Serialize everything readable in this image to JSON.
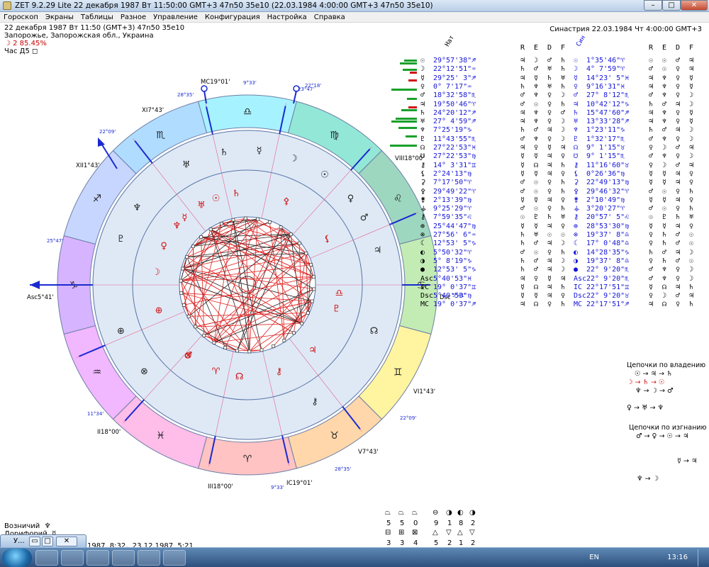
{
  "window": {
    "title": "ZET 9.2.29 Lite   22 декабря 1987  Вт  11:50:00 GMT+3 47n50  35e10   (22.03.1984   4:00:00 GMT+3 47n50 35e10)"
  },
  "menu": [
    "Гороскоп",
    "Экраны",
    "Таблицы",
    "Разное",
    "Управление",
    "Конфигурация",
    "Настройка",
    "Справка"
  ],
  "info": {
    "line1": "22 декабря 1987  Вт  11:50 (GMT+3)  47n50  35e10",
    "line2": "Запорожье, Запорожская обл., Украина",
    "line3": "☽   2  85.45%",
    "line4": "Час Д5  ◻",
    "right": "Синастрия 22.03.1984  Чт  4:00:00 GMT+3"
  },
  "wheel": {
    "mc": "MC19°01'",
    "asc": "Asc5°41'",
    "dsc": "Dsc",
    "ic": "IC19°01'",
    "vi": "VI1°43'",
    "v": "V7°43'",
    "xi": "XI7°43'",
    "xii": "XII1°43'",
    "ii": "II18°00'",
    "iii": "III18°00'",
    "viii": "VIII18°00'",
    "t1": "28°35'",
    "t2": "9°33'",
    "t3": "22°18'",
    "t4": "23°47'",
    "t5": "22°09'",
    "t6": "25°47'",
    "t7": "11°34'",
    "t8": "22°09'",
    "t9": "28°35'",
    "t10": "9°33'",
    "t11": "5°41'",
    "signs": [
      "♐",
      "♏",
      "♎",
      "♍",
      "♌",
      "♋",
      "♊",
      "♉",
      "♈",
      "♓",
      "♒",
      "♑"
    ]
  },
  "table": {
    "headers": [
      "Нат",
      "R",
      "E",
      "D",
      "F",
      "Син",
      "R",
      "E",
      "D",
      "F"
    ],
    "rows": [
      [
        "☉",
        "29°57'38\"♐",
        "♃",
        "☽",
        "♂",
        "♄",
        "☉",
        "1°35'46\"♈",
        "☉",
        "☉",
        "♂",
        "♃"
      ],
      [
        "☽",
        "22°12'51\"♒",
        "♄",
        "♂",
        "♅",
        "♄",
        "☽",
        "4° 7'59\"♈",
        "♂",
        "☉",
        "♀",
        "♃"
      ],
      [
        "☿",
        "29°25' 3\"♐",
        "♃",
        "☿",
        "♄",
        "♅",
        "☿",
        "14°23' 5\"♓",
        "♃",
        "♆",
        "♀",
        "☿"
      ],
      [
        "♀",
        "0° 7'17\"♒",
        "♄",
        "♆",
        "♅",
        "♄",
        "♀",
        "9°16'31\"♓",
        "♃",
        "♆",
        "♀",
        "☿"
      ],
      [
        "♂",
        "18°32'58\"♏",
        "♂",
        "♆",
        "♀",
        "☽",
        "♂",
        "27° 8'12\"♏",
        "♂",
        "♆",
        "♀",
        "☽"
      ],
      [
        "♃",
        "19°50'46\"♈",
        "♂",
        "☉",
        "♀",
        "♄",
        "♃",
        "10°42'12\"♑",
        "♄",
        "♂",
        "♃",
        "☽"
      ],
      [
        "♄",
        "24°20'12\"♐",
        "♃",
        "♆",
        "♀",
        "♂",
        "♄",
        "15°47'60\"♐",
        "♃",
        "♆",
        "♀",
        "☿"
      ],
      [
        "♅",
        "27° 4'59\"♐",
        "♃",
        "♆",
        "♀",
        "☽",
        "♅",
        "13°33'28\"♐",
        "♃",
        "♆",
        "♀",
        "☿"
      ],
      [
        "♆",
        "7°25'19\"♑",
        "♄",
        "♂",
        "♃",
        "☽",
        "♆",
        "1°23'11\"♑",
        "♄",
        "♂",
        "♃",
        "☽"
      ],
      [
        "♇",
        "11°43'55\"♏",
        "♂",
        "♆",
        "♀",
        "☽",
        "♇",
        "1°32'17\"♏",
        "♂",
        "♆",
        "♀",
        "☽"
      ],
      [
        "☊",
        "27°22'53\"♓",
        "♃",
        "♀",
        "☿",
        "♃",
        "☊",
        "9° 1'15\"♉",
        "♀",
        "☽",
        "♂",
        "♃"
      ],
      [
        "☋",
        "27°22'53\"♍",
        "☿",
        "☿",
        "♃",
        "♀",
        "☋",
        "9° 1'15\"♏",
        "♂",
        "♆",
        "♀",
        "☽"
      ],
      [
        "⚷",
        "14° 3'31\"♊",
        "☿",
        "☊",
        "♃",
        "♄",
        "⚷",
        "11°16'60\"♉",
        "♀",
        "☽",
        "♂",
        "♃"
      ],
      [
        "⚸",
        "2°24'13\"♍",
        "☿",
        "☿",
        "♃",
        "♀",
        "⚸",
        "0°26'36\"♍",
        "☿",
        "☿",
        "♃",
        "♀"
      ],
      [
        "⚳",
        "7°17'50\"♈",
        "♂",
        "☉",
        "♀",
        "♄",
        "⚳",
        "22°49'13\"♍",
        "☿",
        "☿",
        "♃",
        "♀"
      ],
      [
        "⚴",
        "29°49'22\"♈",
        "♂",
        "☉",
        "♀",
        "♄",
        "⚴",
        "29°46'32\"♈",
        "♂",
        "☉",
        "♀",
        "♄"
      ],
      [
        "⚵",
        "2°13'39\"♍",
        "☿",
        "☿",
        "♃",
        "♀",
        "⚵",
        "2°10'49\"♍",
        "☿",
        "☿",
        "♃",
        "♀"
      ],
      [
        "⚶",
        "9°25'29\"♈",
        "♂",
        "☉",
        "♀",
        "♄",
        "⚶",
        "3°20'27\"♈",
        "♂",
        "☉",
        "♀",
        "♄"
      ],
      [
        "⚷",
        "7°59'35\"♌",
        "☉",
        "♇",
        "♄",
        "♅",
        "⚷",
        "20°57' 5\"♌",
        "☉",
        "♇",
        "♄",
        "♅"
      ],
      [
        "⊕",
        "25°44'47\"♍",
        "☿",
        "☿",
        "♃",
        "♀",
        "⊕",
        "28°53'30\"♍",
        "☿",
        "☿",
        "♃",
        "♀"
      ],
      [
        "⊗",
        "27°56' 6\"♒",
        "♄",
        "♅",
        "☉",
        "☉",
        "⊗",
        "19°37' 8\"♎",
        "♀",
        "♄",
        "♂",
        "☉"
      ],
      [
        "☾",
        "12°53' 5\"♑",
        "♄",
        "♂",
        "♃",
        "☽",
        "☾",
        "17° 0'48\"♎",
        "♀",
        "♄",
        "♂",
        "☉"
      ],
      [
        "◐",
        "5°50'32\"♈",
        "♂",
        "☉",
        "♀",
        "♄",
        "◐",
        "14°28'35\"♑",
        "♄",
        "♂",
        "♃",
        "☽"
      ],
      [
        "◑",
        "5° 8'19\"♑",
        "♄",
        "♂",
        "♃",
        "☽",
        "◑",
        "19°37' 8\"♎",
        "♀",
        "♄",
        "♂",
        "☉"
      ],
      [
        "●",
        "12°53' 5\"♑",
        "♄",
        "♂",
        "♃",
        "☽",
        "●",
        "22° 9'20\"♏",
        "♂",
        "♆",
        "♀",
        "☽"
      ],
      [
        "Asc",
        "5°40'53\"♓",
        "♃",
        "♀",
        "☿",
        "♃",
        "Asc",
        "22° 9'20\"♏",
        "♂",
        "♆",
        "♀",
        "☽"
      ],
      [
        "IC",
        "19° 0'37\"♊",
        "☿",
        "☊",
        "♃",
        "♄",
        "IC",
        "22°17'51\"♊",
        "☿",
        "☊",
        "♃",
        "♄"
      ],
      [
        "Dsc",
        "5°40'53\"♍",
        "☿",
        "☿",
        "♃",
        "♀",
        "Dsc",
        "22° 9'20\"♉",
        "♀",
        "☽",
        "♂",
        "♃"
      ],
      [
        "MC",
        "19° 0'37\"♐",
        "♃",
        "☊",
        "♀",
        "♄",
        "MC",
        "22°17'51\"♐",
        "♃",
        "☊",
        "♀",
        "♄"
      ]
    ]
  },
  "chains": {
    "title1": "Цепочки по владению",
    "title2": "Цепочки по изгнанию",
    "c1": [
      "☉ → ♃ → ♄",
      "☽ → ♄ → ☉",
      "♆ → ☽ → ♂",
      "♀ → ♅ → ♆"
    ],
    "c2": [
      "♂ → ♀ → ☉ → ♃",
      "♆ → ☽",
      "☿ → ♃"
    ]
  },
  "bottom": {
    "line1": "Возничий  ♆",
    "line2": "Дорифорий  ☿",
    "counts_top": [
      "5",
      "5",
      "0",
      "9",
      "1",
      "8",
      "2"
    ],
    "counts_bottom": [
      "3",
      "3",
      "4",
      "5",
      "2",
      "1",
      "2"
    ],
    "status": "1987  8:32,  23.12.1987  5:21"
  },
  "taskbar": {
    "mini_title": "У...",
    "lang": "EN",
    "time": "13:16"
  }
}
